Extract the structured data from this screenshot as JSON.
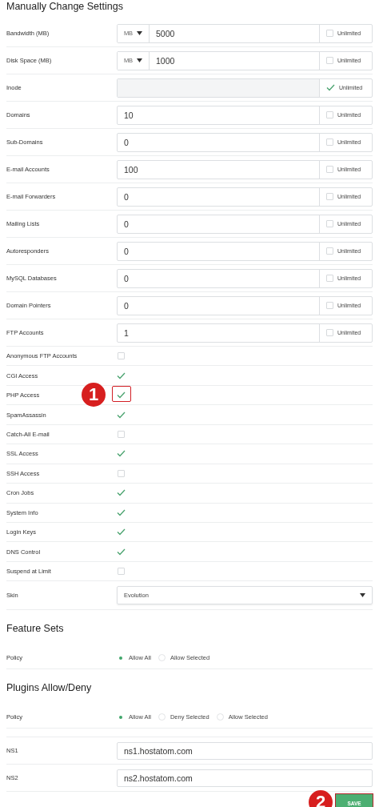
{
  "title": "Manually Change Settings",
  "limits": [
    {
      "label": "Bandwidth (MB)",
      "kind": "unit",
      "unit": "MB",
      "value": "5000",
      "unlimited_label": "Unlimited",
      "unlimited": false
    },
    {
      "label": "Disk Space (MB)",
      "kind": "unit",
      "unit": "MB",
      "value": "1000",
      "unlimited_label": "Unlimited",
      "unlimited": false
    },
    {
      "label": "Inode",
      "kind": "number",
      "unlimited_label": "Unlimited",
      "unlimited": true
    },
    {
      "label": "Domains",
      "kind": "number",
      "value": "10",
      "unlimited_label": "Unlimited",
      "unlimited": false
    },
    {
      "label": "Sub-Domains",
      "kind": "number",
      "value": "0",
      "unlimited_label": "Unlimited",
      "unlimited": false
    },
    {
      "label": "E-mail Accounts",
      "kind": "number",
      "value": "100",
      "unlimited_label": "Unlimited",
      "unlimited": false
    },
    {
      "label": "E-mail Forwarders",
      "kind": "number",
      "value": "0",
      "unlimited_label": "Unlimited",
      "unlimited": false
    },
    {
      "label": "Mailing Lists",
      "kind": "number",
      "value": "0",
      "unlimited_label": "Unlimited",
      "unlimited": false
    },
    {
      "label": "Autoresponders",
      "kind": "number",
      "value": "0",
      "unlimited_label": "Unlimited",
      "unlimited": false
    },
    {
      "label": "MySQL Databases",
      "kind": "number",
      "value": "0",
      "unlimited_label": "Unlimited",
      "unlimited": false
    },
    {
      "label": "Domain Pointers",
      "kind": "number",
      "value": "0",
      "unlimited_label": "Unlimited",
      "unlimited": false
    },
    {
      "label": "FTP Accounts",
      "kind": "number",
      "value": "1",
      "unlimited_label": "Unlimited",
      "unlimited": false
    }
  ],
  "features": [
    {
      "label": "Anonymous FTP Accounts",
      "checked": false
    },
    {
      "label": "CGI Access",
      "checked": true
    },
    {
      "label": "PHP Access",
      "checked": true,
      "highlighted": true,
      "marker": "1"
    },
    {
      "label": "SpamAssassin",
      "checked": true
    },
    {
      "label": "Catch-All E-mail",
      "checked": false
    },
    {
      "label": "SSL Access",
      "checked": true
    },
    {
      "label": "SSH Access",
      "checked": false
    },
    {
      "label": "Cron Jobs",
      "checked": true
    },
    {
      "label": "System Info",
      "checked": true
    },
    {
      "label": "Login Keys",
      "checked": true
    },
    {
      "label": "DNS Control",
      "checked": true
    },
    {
      "label": "Suspend at Limit",
      "checked": false
    }
  ],
  "skin": {
    "label": "Skin",
    "value": "Evolution"
  },
  "feature_sets": {
    "title": "Feature Sets",
    "policy_label": "Policy",
    "options": [
      {
        "label": "Allow All",
        "selected": true
      },
      {
        "label": "Allow Selected",
        "selected": false
      }
    ]
  },
  "plugins": {
    "title": "Plugins Allow/Deny",
    "policy_label": "Policy",
    "options": [
      {
        "label": "Allow All",
        "selected": true
      },
      {
        "label": "Deny Selected",
        "selected": false
      },
      {
        "label": "Allow Selected",
        "selected": false
      }
    ]
  },
  "nameservers": [
    {
      "label": "NS1",
      "value": "ns1.hostatom.com"
    },
    {
      "label": "NS2",
      "value": "ns2.hostatom.com"
    }
  ],
  "save": {
    "label": "SAVE",
    "highlighted": true,
    "marker": "2"
  }
}
